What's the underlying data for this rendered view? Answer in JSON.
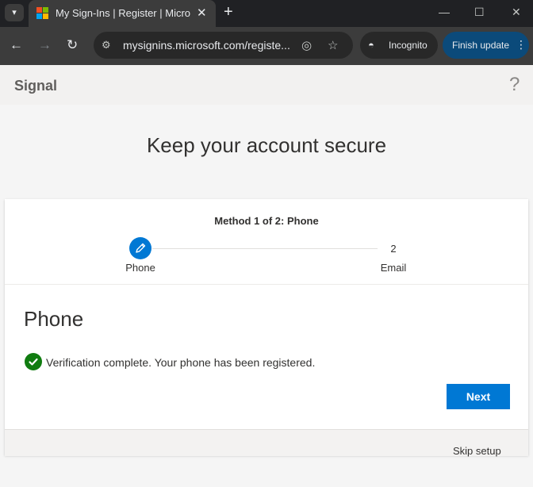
{
  "browser": {
    "tab_title": "My Sign-Ins | Register | Microsoft",
    "url": "mysignins.microsoft.com/registe...",
    "incognito_label": "Incognito",
    "finish_update_label": "Finish update",
    "logo_colors": [
      "#f25022",
      "#7fba00",
      "#00a4ef",
      "#ffb900"
    ]
  },
  "header": {
    "brand": "Signal",
    "help_glyph": "?"
  },
  "page": {
    "title": "Keep your account secure"
  },
  "wizard": {
    "method_label": "Method 1 of 2: Phone",
    "steps": [
      {
        "label": "Phone",
        "status": "current"
      },
      {
        "label": "Email",
        "number": "2",
        "status": "upcoming"
      }
    ]
  },
  "content": {
    "section_title": "Phone",
    "status_message": "Verification complete. Your phone has been registered.",
    "next_label": "Next",
    "skip_label": "Skip setup"
  },
  "colors": {
    "accent": "#0078d4",
    "success": "#107c10"
  }
}
